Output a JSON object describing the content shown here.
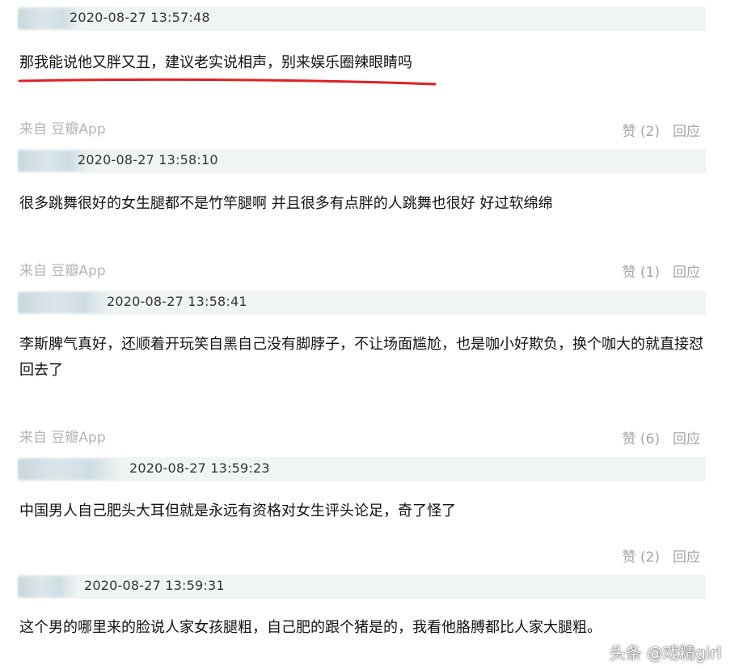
{
  "comments": [
    {
      "timestamp": "2020-08-27 13:57:48",
      "text": "那我能说他又胖又丑，建议老实说相声，别来娱乐圈辣眼睛吗",
      "source": "来自 豆瓣App",
      "like": "赞 (2)",
      "reply": "回应"
    },
    {
      "timestamp": "2020-08-27 13:58:10",
      "text": "很多跳舞很好的女生腿都不是竹竿腿啊 并且很多有点胖的人跳舞也很好 好过软绵绵",
      "source": "来自 豆瓣App",
      "like": "赞 (1)",
      "reply": "回应"
    },
    {
      "timestamp": "2020-08-27 13:58:41",
      "text": "李斯脾气真好，还顺着开玩笑自黑自己没有脚脖子，不让场面尴尬，也是咖小好欺负，换个咖大的就直接怼回去了",
      "source": "来自 豆瓣App",
      "like": "赞 (6)",
      "reply": "回应"
    },
    {
      "timestamp": "2020-08-27 13:59:23",
      "text": "中国男人自己肥头大耳但就是永远有资格对女生评头论足，奇了怪了",
      "source": "",
      "like": "赞 (2)",
      "reply": "回应"
    },
    {
      "timestamp": "2020-08-27 13:59:31",
      "text": "这个男的哪里来的脸说人家女孩腿粗，自己肥的跟个猪是的，我看他胳膊都比人家大腿粗。",
      "source": "",
      "like": "",
      "reply": ""
    }
  ],
  "watermark": "头条 @戏精girl",
  "colors": {
    "highlight": "#e02020",
    "meta_bg": "#f0f5f3",
    "muted": "#a5a5a5"
  }
}
